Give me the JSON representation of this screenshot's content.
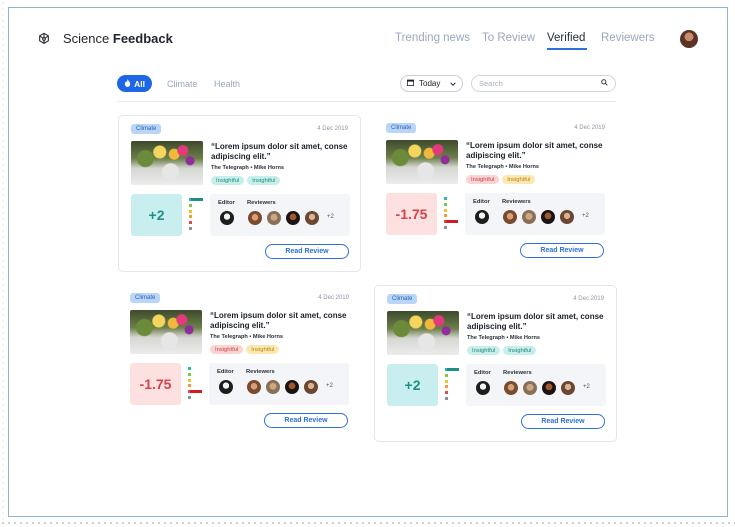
{
  "header": {
    "brand_prefix": "Science ",
    "brand_bold": "Feedback",
    "nav": [
      "Trending news",
      "To Review",
      "Verified",
      "Reviewers"
    ],
    "active_nav": "Verified"
  },
  "filters": {
    "all_label": "All",
    "topics": [
      "Climate",
      "Health"
    ],
    "date_select": "Today",
    "search_placeholder": "Search"
  },
  "cards": [
    {
      "topic": "Climate",
      "date": "4 Dec 2019",
      "headline": "“Lorem ipsum dolor sit amet, conse adipiscing elit.”",
      "source": "The Telegraph • Mike Horns",
      "tags": [
        "Insightful",
        "Insightful"
      ],
      "score": "+2",
      "editor_label": "Editor",
      "reviewers_label": "Reviewers",
      "more": "+2",
      "button": "Read Review"
    },
    {
      "topic": "Climate",
      "date": "4 Dec 2019",
      "headline": "“Lorem ipsum dolor sit amet, conse adipiscing elit.”",
      "source": "The Telegraph • Mike Horns",
      "tags": [
        "Insightful",
        "Insightful"
      ],
      "score": "-1.75",
      "editor_label": "Editor",
      "reviewers_label": "Reviewers",
      "more": "+2",
      "button": "Read Review"
    },
    {
      "topic": "Climate",
      "date": "4 Dec 2019",
      "headline": "“Lorem ipsum dolor sit amet, conse adipiscing elit.”",
      "source": "The Telegraph • Mike Horns",
      "tags": [
        "Insightful",
        "Insightful"
      ],
      "score": "-1.75",
      "editor_label": "Editor",
      "reviewers_label": "Reviewers",
      "more": "+2",
      "button": "Read Review"
    },
    {
      "topic": "Climate",
      "date": "4 Dec 2019",
      "headline": "“Lorem ipsum dolor sit amet, conse adipiscing elit.”",
      "source": "The Telegraph • Mike Horns",
      "tags": [
        "Insightful",
        "Insightful"
      ],
      "score": "+2",
      "editor_label": "Editor",
      "reviewers_label": "Reviewers",
      "more": "+2",
      "button": "Read Review"
    }
  ],
  "colors": {
    "accent": "#1e66e6",
    "positive": "#1e8f87",
    "negative": "#d54349"
  }
}
